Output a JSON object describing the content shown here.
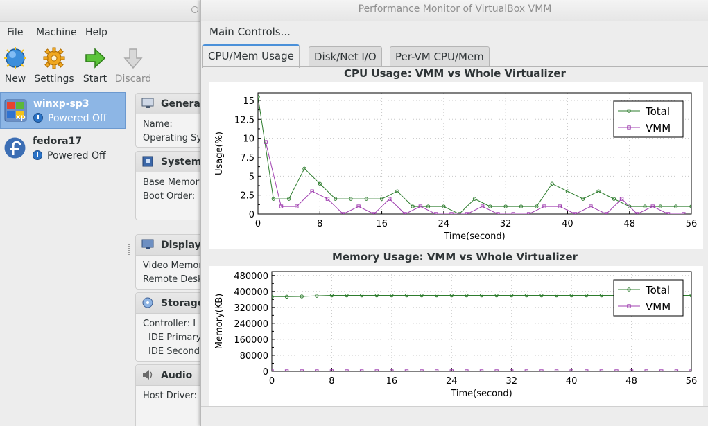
{
  "vbox": {
    "menu": [
      "File",
      "Machine",
      "Help"
    ],
    "toolbar": [
      {
        "label": "New",
        "icon": "new-icon"
      },
      {
        "label": "Settings",
        "icon": "settings-gear-icon"
      },
      {
        "label": "Start",
        "icon": "start-arrow-icon"
      },
      {
        "label": "Discard",
        "icon": "discard-arrow-icon"
      }
    ],
    "vms": [
      {
        "name": "winxp-sp3",
        "state": "Powered Off",
        "icon": "windows-xp-icon"
      },
      {
        "name": "fedora17",
        "state": "Powered Off",
        "icon": "fedora-icon"
      }
    ],
    "details": {
      "general": {
        "title": "General",
        "lines": [
          "Name:",
          "Operating Sy"
        ]
      },
      "system": {
        "title": "System",
        "lines": [
          "Base Memory",
          "Boot Order:"
        ]
      },
      "display": {
        "title": "Display",
        "lines": [
          "Video Memor",
          "Remote Desk"
        ]
      },
      "storage": {
        "title": "Storage",
        "lines": [
          "Controller: I",
          "IDE Primary",
          "IDE Second"
        ]
      },
      "audio": {
        "title": "Audio",
        "lines": [
          "Host Driver:"
        ]
      }
    }
  },
  "monitor": {
    "window_title": "Performance Monitor of VirtualBox VMM",
    "main_controls": "Main Controls...",
    "tabs": [
      "CPU/Mem Usage",
      "Disk/Net I/O",
      "Per-VM CPU/Mem"
    ],
    "active_tab": 0
  },
  "chart_data": [
    {
      "type": "line",
      "title": "CPU Usage: VMM vs Whole Virtualizer",
      "xlabel": "Time(second)",
      "ylabel": "Usage(%)",
      "xlim": [
        0,
        56
      ],
      "ylim": [
        0,
        16
      ],
      "xticks": [
        0,
        8,
        16,
        24,
        32,
        40,
        48,
        56
      ],
      "yticks": [
        0,
        2.5,
        5,
        7.5,
        10,
        12.5,
        15
      ],
      "ytick_labels": [
        "0",
        "2.5",
        "5",
        "7.5",
        "10",
        "12.5",
        "15"
      ],
      "grid": true,
      "legend": "top-right",
      "x": [
        0,
        1,
        2,
        3,
        4,
        5,
        6,
        7,
        8,
        9,
        10,
        11,
        12,
        13,
        14,
        15,
        16,
        17,
        18,
        19,
        20,
        21,
        22,
        23,
        24,
        25,
        26,
        27,
        28,
        29,
        30,
        31,
        32,
        33,
        34,
        35,
        36,
        37,
        38,
        39,
        40,
        41,
        42,
        43,
        44,
        45,
        46,
        47,
        48,
        49,
        50,
        51,
        52,
        53,
        54,
        55,
        56
      ],
      "series": [
        {
          "name": "Total",
          "color": "#2e7d2e",
          "marker": "circle",
          "values": [
            15.5,
            null,
            2,
            null,
            2,
            null,
            6,
            null,
            4,
            null,
            2,
            null,
            2,
            null,
            2,
            null,
            2,
            null,
            3,
            null,
            1,
            null,
            1,
            null,
            1,
            null,
            0,
            null,
            2,
            null,
            1,
            null,
            1,
            null,
            1,
            null,
            1,
            null,
            4,
            null,
            3,
            null,
            2,
            null,
            3,
            null,
            2,
            null,
            1,
            null,
            1,
            null,
            1,
            null,
            1,
            null,
            1
          ]
        },
        {
          "name": "VMM",
          "color": "#a040b0",
          "marker": "square",
          "values": [
            null,
            9.5,
            null,
            1,
            null,
            1,
            null,
            3,
            null,
            2,
            null,
            0,
            null,
            1,
            null,
            0,
            null,
            2,
            null,
            0,
            null,
            1,
            null,
            0,
            null,
            0,
            null,
            0,
            null,
            1,
            null,
            0,
            null,
            0,
            null,
            0,
            null,
            1,
            null,
            1,
            null,
            0,
            null,
            1,
            null,
            0,
            null,
            2,
            null,
            0,
            null,
            1,
            null,
            0,
            null,
            0,
            null
          ]
        }
      ]
    },
    {
      "type": "line",
      "title": "Memory Usage: VMM vs Whole Virtualizer",
      "xlabel": "Time(second)",
      "ylabel": "Memory(KB)",
      "xlim": [
        0,
        56
      ],
      "ylim": [
        0,
        500000
      ],
      "xticks": [
        0,
        8,
        16,
        24,
        32,
        40,
        48,
        56
      ],
      "yticks": [
        0,
        80000,
        160000,
        240000,
        320000,
        400000,
        480000
      ],
      "ytick_labels": [
        "0",
        "80000",
        "160000",
        "240000",
        "320000",
        "400000",
        "480000"
      ],
      "grid": true,
      "legend": "top-right",
      "x": [
        0,
        2,
        4,
        6,
        8,
        10,
        12,
        14,
        16,
        18,
        20,
        22,
        24,
        26,
        28,
        30,
        32,
        34,
        36,
        38,
        40,
        42,
        44,
        46,
        48,
        50,
        52,
        54,
        56
      ],
      "series": [
        {
          "name": "Total",
          "color": "#2e7d2e",
          "marker": "circle",
          "values": [
            374000,
            374000,
            375000,
            378000,
            380000,
            380000,
            380000,
            380000,
            380000,
            380000,
            380000,
            380000,
            380000,
            380000,
            380000,
            380000,
            380000,
            380000,
            380000,
            380000,
            380000,
            380000,
            380000,
            380000,
            380000,
            380000,
            380000,
            380000,
            380000
          ]
        },
        {
          "name": "VMM",
          "color": "#a040b0",
          "marker": "square",
          "values": [
            0,
            0,
            0,
            0,
            0,
            0,
            0,
            0,
            0,
            0,
            0,
            0,
            0,
            0,
            0,
            0,
            0,
            0,
            0,
            0,
            0,
            0,
            0,
            0,
            0,
            0,
            0,
            0,
            0
          ]
        }
      ]
    }
  ]
}
